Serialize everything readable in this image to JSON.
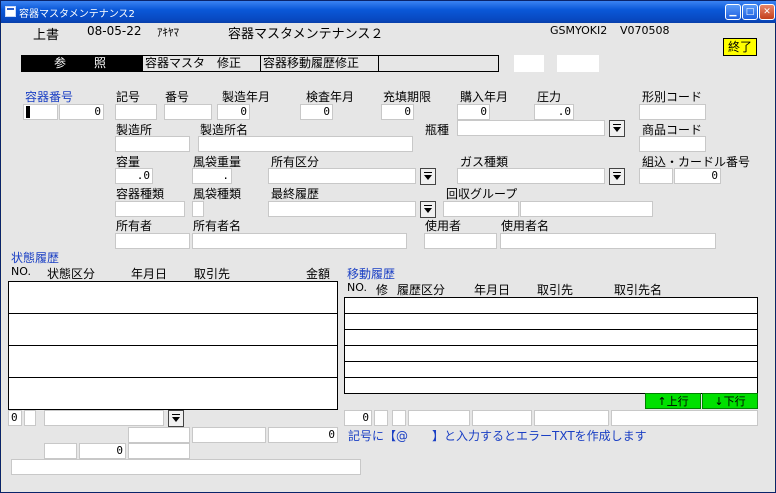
{
  "window": {
    "title": "容器マスタメンテナンス2"
  },
  "header": {
    "mode_label": "上書",
    "date": "08-05-22",
    "user": "ｱｷﾔﾏ",
    "screen_title": "容器マスタメンテナンス２",
    "terminal": "GSMYOKI2",
    "version": "V070508",
    "end_button": "終了"
  },
  "modebar": {
    "tab_ref_a": "参",
    "tab_ref_b": "照",
    "tab_edit": "容器マスタ　修正",
    "tab_move_edit": "容器移動履歴修正"
  },
  "fields": {
    "container_no_label": "容器番号",
    "container_no_value": "0",
    "symbol_label": "記号",
    "number_label": "番号",
    "mfg_year_label": "製造年月",
    "mfg_year_value": "0",
    "inspect_year_label": "検査年月",
    "inspect_year_value": "0",
    "fill_limit_label": "充填期限",
    "fill_limit_value": "0",
    "purchase_label": "購入年月",
    "purchase_value": "0",
    "pressure_label": "圧力",
    "pressure_value": ".0",
    "model_code_label": "形別コード",
    "factory_label": "製造所",
    "factory_name_label": "製造所名",
    "cylinder_type_label": "瓶種",
    "product_code_label": "商品コード",
    "capacity_label": "容量",
    "capacity_value": ".0",
    "bag_weight_label": "風袋重量",
    "bag_weight_value": ".",
    "ownership_label": "所有区分",
    "gas_type_label": "ガス種類",
    "card_no_label": "組込・カードル番号",
    "card_no_value": "0",
    "container_kind_label": "容器種類",
    "bag_kind_label": "風袋種類",
    "last_history_label": "最終履歴",
    "collect_group_label": "回収グループ",
    "owner_label": "所有者",
    "owner_name_label": "所有者名",
    "user_label": "使用者",
    "user_name_label": "使用者名"
  },
  "status_history": {
    "title": "状態履歴",
    "col_no": "NO.",
    "col_status": "状態区分",
    "col_date": "年月日",
    "col_partner": "取引先",
    "col_amount": "金額",
    "bottom_no": "0",
    "total_amount": "0",
    "bottom_count": "0"
  },
  "move_history": {
    "title": "移動履歴",
    "col_no": "NO.",
    "col_fix": "修",
    "col_kind": "履歴区分",
    "col_date": "年月日",
    "col_partner": "取引先",
    "col_partner_name": "取引先名",
    "btn_up": "↑上行",
    "btn_down": "↓下行",
    "bottom_no": "0",
    "hint": "記号に【@　　】と入力するとエラーTXTを作成します"
  }
}
